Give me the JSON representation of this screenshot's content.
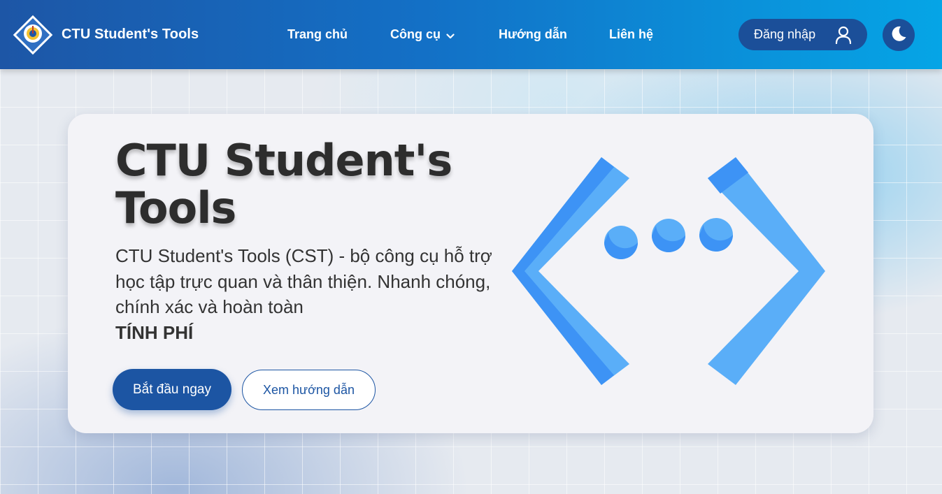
{
  "header": {
    "brand": "CTU Student's Tools",
    "logo_icon": "university-seal-logo",
    "nav": [
      {
        "label": "Trang chủ"
      },
      {
        "label": "Công cụ",
        "has_dropdown": true
      },
      {
        "label": "Hướng dẫn"
      },
      {
        "label": "Liên hệ"
      }
    ],
    "login_label": "Đăng nhập",
    "login_icon": "user-icon",
    "theme_icon": "moon-icon"
  },
  "hero": {
    "title": "CTU Student's Tools",
    "description": "CTU Student's Tools (CST) - bộ công cụ hỗ trợ học tập trực quan và thân thiện. Nhanh chóng, chính xác và hoàn toàn",
    "description_strong": "TÍNH PHÍ",
    "primary_button": "Bắt đầu ngay",
    "secondary_button": "Xem hướng dẫn",
    "illustration_icon": "code-brackets-dots-icon"
  },
  "colors": {
    "header_start": "#1d56a6",
    "header_end": "#05a5e6",
    "primary": "#1c55a3",
    "accent_blue": "#3d93f5",
    "accent_light": "#5aaef8",
    "card_bg": "#f3f3f7",
    "title_text": "#2d2d2d"
  }
}
